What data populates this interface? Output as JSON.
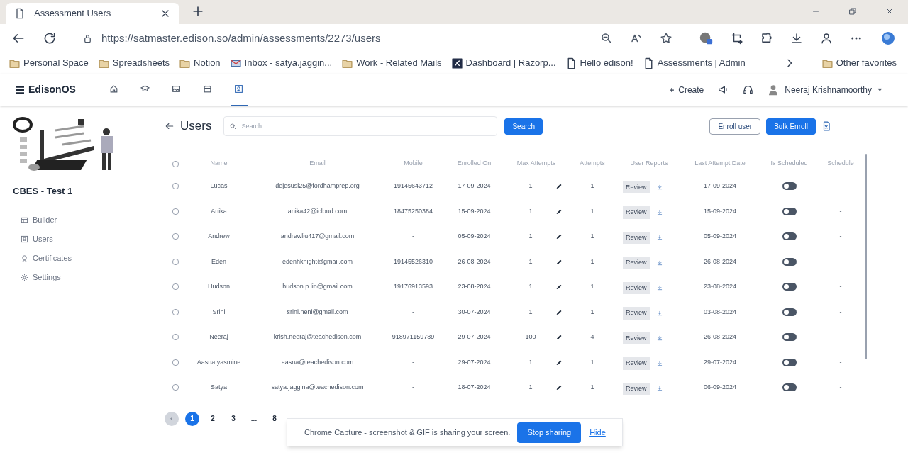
{
  "browser": {
    "tab_title": "Assessment Users",
    "url": "https://satmaster.edison.so/admin/assessments/2273/users",
    "bookmarks": [
      {
        "kind": "folder",
        "label": "Personal Space"
      },
      {
        "kind": "folder",
        "label": "Spreadsheets"
      },
      {
        "kind": "folder",
        "label": "Notion"
      },
      {
        "kind": "mail",
        "label": "Inbox - satya.jaggin..."
      },
      {
        "kind": "folder",
        "label": "Work - Related Mails"
      },
      {
        "kind": "app",
        "label": "Dashboard | Razorp..."
      },
      {
        "kind": "page",
        "label": "Hello edison!"
      },
      {
        "kind": "page",
        "label": "Assessments | Admin"
      }
    ],
    "other_favorites": "Other favorites"
  },
  "app": {
    "logo": "EdisonOS",
    "nav_tabs": [
      {
        "kind": "home",
        "selected": false
      },
      {
        "kind": "cap",
        "selected": false
      },
      {
        "kind": "image",
        "selected": false
      },
      {
        "kind": "calendar",
        "selected": false
      },
      {
        "kind": "users",
        "selected": true
      }
    ],
    "create": "Create",
    "user_name": "Neeraj Krishnamoorthy"
  },
  "sidebar": {
    "title": "CBES - Test 1",
    "items": [
      {
        "kind": "builder",
        "label": "Builder"
      },
      {
        "kind": "users",
        "label": "Users"
      },
      {
        "kind": "certificates",
        "label": "Certificates"
      },
      {
        "kind": "settings",
        "label": "Settings"
      }
    ]
  },
  "page": {
    "title": "Users",
    "search_placeholder": "Search",
    "search_button": "Search",
    "enroll_user": "Enroll user",
    "bulk_enroll": "Bulk Enroll"
  },
  "table": {
    "select_all_checked": false,
    "columns": [
      "Name",
      "Email",
      "Mobile",
      "Enrolled On",
      "Max Attempts",
      "Attempts",
      "User Reports",
      "Last Attempt Date",
      "Is Scheduled",
      "Schedule"
    ],
    "rows": [
      {
        "checked": false,
        "name": "Lucas",
        "email": "dejesusl25@fordhamprep.org",
        "mobile": "19145643712",
        "enrolled": "17-09-2024",
        "max_attempts": "1",
        "attempts": "1",
        "report": "Review",
        "last_attempt": "17-09-2024",
        "scheduled": false,
        "schedule": "-"
      },
      {
        "checked": false,
        "name": "Anika",
        "email": "anika42@icloud.com",
        "mobile": "18475250384",
        "enrolled": "15-09-2024",
        "max_attempts": "1",
        "attempts": "1",
        "report": "Review",
        "last_attempt": "15-09-2024",
        "scheduled": false,
        "schedule": "-"
      },
      {
        "checked": false,
        "name": "Andrew",
        "email": "andrewliu417@gmail.com",
        "mobile": "-",
        "enrolled": "05-09-2024",
        "max_attempts": "1",
        "attempts": "1",
        "report": "Review",
        "last_attempt": "05-09-2024",
        "scheduled": false,
        "schedule": "-"
      },
      {
        "checked": false,
        "name": "Eden",
        "email": "edenhknight@gmail.com",
        "mobile": "19145526310",
        "enrolled": "26-08-2024",
        "max_attempts": "1",
        "attempts": "1",
        "report": "Review",
        "last_attempt": "26-08-2024",
        "scheduled": false,
        "schedule": "-"
      },
      {
        "checked": false,
        "name": "Hudson",
        "email": "hudson.p.lin@gmail.com",
        "mobile": "19176913593",
        "enrolled": "23-08-2024",
        "max_attempts": "1",
        "attempts": "1",
        "report": "Review",
        "last_attempt": "23-08-2024",
        "scheduled": false,
        "schedule": "-"
      },
      {
        "checked": false,
        "name": "Srini",
        "email": "srini.neni@gmail.com",
        "mobile": "-",
        "enrolled": "30-07-2024",
        "max_attempts": "1",
        "attempts": "1",
        "report": "Review",
        "last_attempt": "03-08-2024",
        "scheduled": false,
        "schedule": "-"
      },
      {
        "checked": false,
        "name": "Neeraj",
        "email": "krish.neeraj@teachedison.com",
        "mobile": "918971159789",
        "enrolled": "29-07-2024",
        "max_attempts": "100",
        "attempts": "4",
        "report": "Review",
        "last_attempt": "26-08-2024",
        "scheduled": false,
        "schedule": "-"
      },
      {
        "checked": false,
        "name": "Aasna yasmine",
        "email": "aasna@teachedison.com",
        "mobile": "-",
        "enrolled": "29-07-2024",
        "max_attempts": "1",
        "attempts": "1",
        "report": "Review",
        "last_attempt": "29-07-2024",
        "scheduled": false,
        "schedule": "-"
      },
      {
        "checked": false,
        "name": "Satya",
        "email": "satya.jaggina@teachedison.com",
        "mobile": "-",
        "enrolled": "18-07-2024",
        "max_attempts": "1",
        "attempts": "1",
        "report": "Review",
        "last_attempt": "06-09-2024",
        "scheduled": false,
        "schedule": "-"
      }
    ]
  },
  "pagination": [
    {
      "label": "1",
      "selected": true
    },
    {
      "label": "2",
      "selected": false
    },
    {
      "label": "3",
      "selected": false
    },
    {
      "label": "...",
      "selected": false
    },
    {
      "label": "8",
      "selected": false
    }
  ],
  "share_bar": {
    "message": "Chrome Capture - screenshot & GIF is sharing your screen.",
    "stop": "Stop sharing",
    "hide": "Hide"
  }
}
